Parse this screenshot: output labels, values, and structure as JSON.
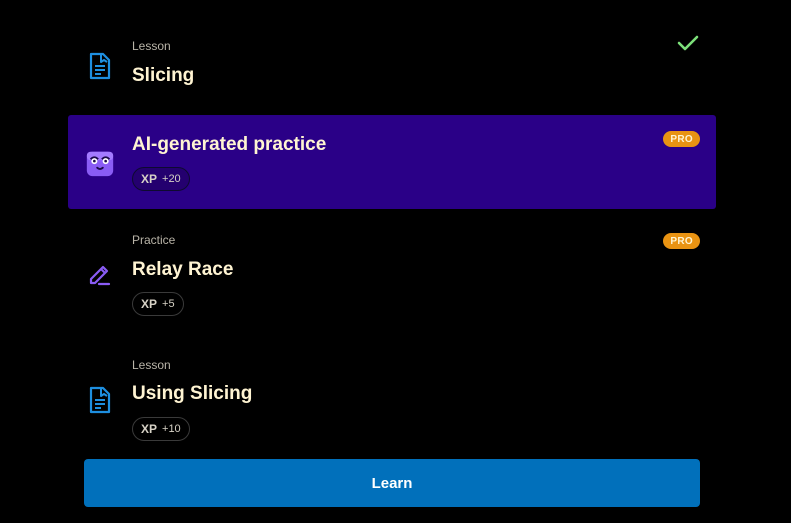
{
  "items": [
    {
      "kind": "Lesson",
      "title": "Slicing",
      "icon": "lesson-document-icon",
      "completed": true
    },
    {
      "kind": "",
      "title": "AI-generated practice",
      "icon": "ai-robot-icon",
      "xp_label": "XP",
      "xp_value": "+20",
      "badge": "PRO",
      "highlighted": true
    },
    {
      "kind": "Practice",
      "title": "Relay Race",
      "icon": "practice-pencil-icon",
      "xp_label": "XP",
      "xp_value": "+5",
      "badge": "PRO"
    },
    {
      "kind": "Lesson",
      "title": "Using Slicing",
      "icon": "lesson-document-icon",
      "xp_label": "XP",
      "xp_value": "+10"
    }
  ],
  "learn_button": {
    "label": "Learn"
  },
  "colors": {
    "background": "#000000",
    "highlight": "#2a0087",
    "title_text": "#fff4d2",
    "pro_badge": "#e99312",
    "check": "#7de07a",
    "lesson_icon": "#1e8fe0",
    "practice_icon": "#8a5cf5",
    "learn_button": "#0170bb"
  }
}
